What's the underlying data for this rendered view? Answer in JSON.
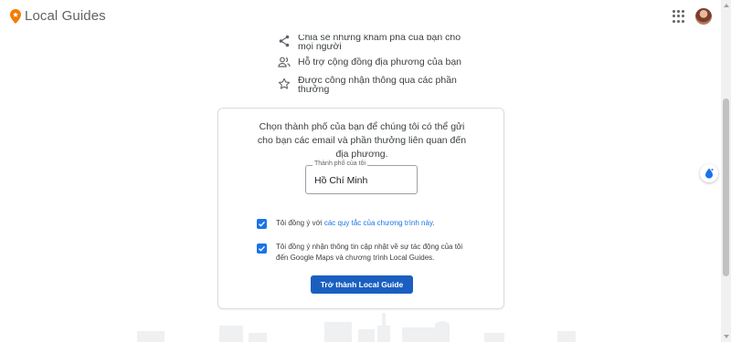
{
  "header": {
    "brand": "Local Guides",
    "icons": {
      "logo": "map-pin-icon",
      "apps": "apps-grid-icon",
      "avatar": "user-avatar"
    },
    "accent_color": "#f57c00"
  },
  "benefits": [
    {
      "icon": "share-icon",
      "label": "Chia sẻ những khám phá của bạn cho mọi người"
    },
    {
      "icon": "people-icon",
      "label": "Hỗ trợ cộng đồng địa phương của bạn"
    },
    {
      "icon": "star-icon",
      "label": "Được công nhận thông qua các phần thưởng"
    }
  ],
  "card": {
    "description": "Chọn thành phố của bạn để chúng tôi có thể gửi cho bạn các email và phần thưởng liên quan đến địa phương.",
    "city_field": {
      "label": "Thành phố của tôi",
      "value": "Hồ Chí Minh"
    },
    "agreements": [
      {
        "checked": true,
        "text": "Tôi đồng ý với ",
        "link": "các quy tắc của chương trình này",
        "suffix": "."
      },
      {
        "checked": true,
        "line1": "Tôi đồng ý nhận thông tin cập nhật về sự tác động của tôi",
        "line2": "đến Google Maps và chương trình Local Guides."
      }
    ],
    "submit_label": "Trở thành Local Guide",
    "button_color": "#1a5fc0",
    "link_color": "#1a73e8"
  }
}
